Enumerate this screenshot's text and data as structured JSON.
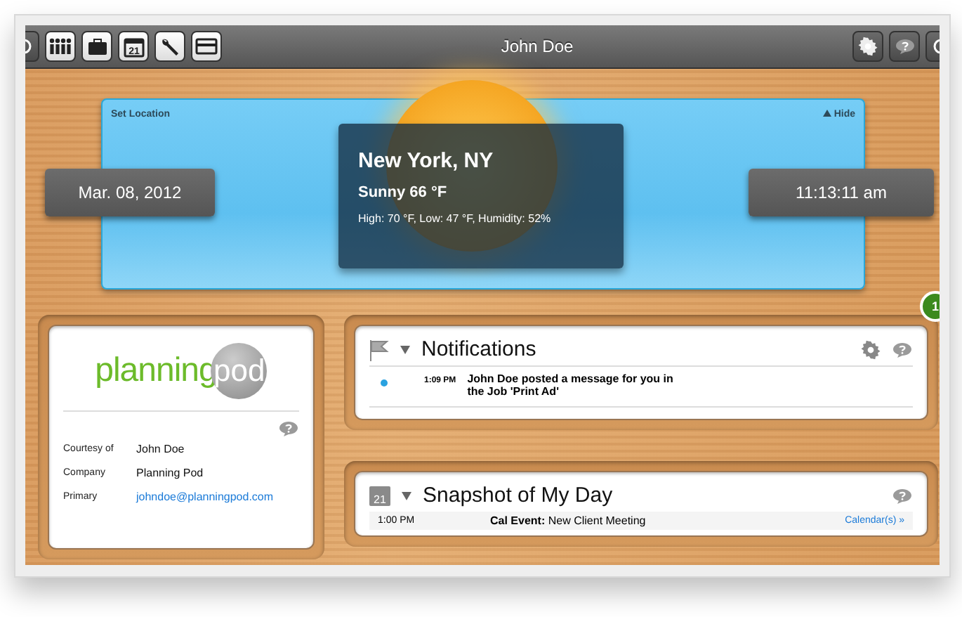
{
  "top_bar": {
    "title": "John Doe",
    "left_icons": [
      {
        "kind": "power"
      },
      {
        "kind": "people"
      },
      {
        "kind": "briefcase"
      },
      {
        "kind": "calendar",
        "day": "21"
      },
      {
        "kind": "wrench"
      },
      {
        "kind": "card"
      }
    ],
    "right_icons": [
      {
        "kind": "gear"
      },
      {
        "kind": "help"
      },
      {
        "kind": "power"
      }
    ]
  },
  "weather": {
    "set_location": "Set Location",
    "hide": "Hide",
    "date": "Mar. 08, 2012",
    "time": "11:13:11 am",
    "city": "New York, NY",
    "condition": "Sunny 66 °F",
    "details": "High: 70 °F, Low: 47 °F, Humidity: 52%"
  },
  "badge": "1",
  "sponsor": {
    "logo_left": "planning",
    "logo_right": "pod",
    "rows": [
      {
        "label": "Courtesy of",
        "value": "John Doe",
        "kind": "text"
      },
      {
        "label": "Company",
        "value": "Planning Pod",
        "kind": "text"
      },
      {
        "label": "Primary",
        "value": "johndoe@planningpod.com",
        "kind": "link"
      }
    ]
  },
  "notifications": {
    "title": "Notifications",
    "items": [
      {
        "time": "1:09 PM",
        "message": "John Doe posted a message for you in the Job 'Print Ad'",
        "unread": true
      }
    ]
  },
  "snapshot": {
    "title": "Snapshot of My Day",
    "calendar_day": "21",
    "items": [
      {
        "time": "1:00 PM",
        "label": "Cal Event:",
        "event": "New Client Meeting",
        "link": "Calendar(s) »"
      }
    ]
  }
}
